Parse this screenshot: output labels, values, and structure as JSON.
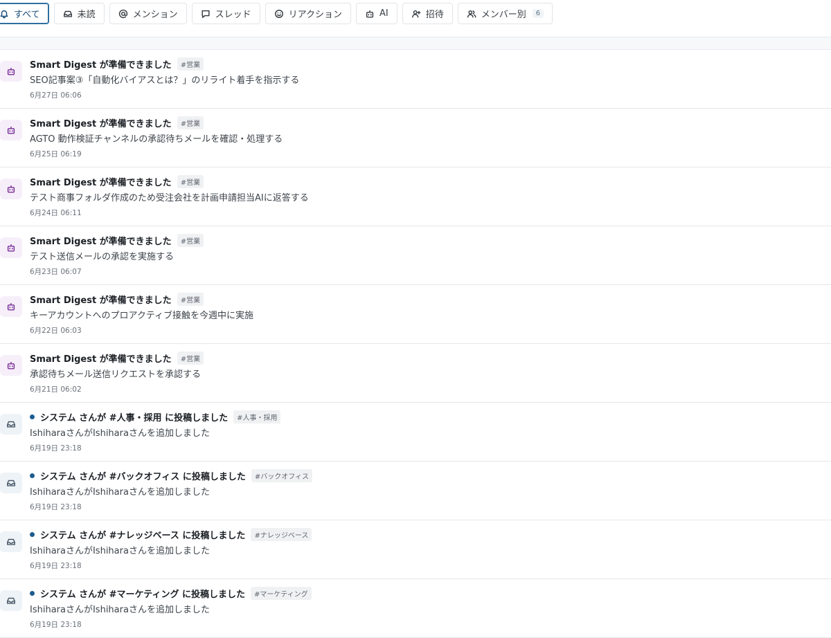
{
  "filters": {
    "all": "すべて",
    "unread": "未読",
    "mentions": "メンション",
    "threads": "スレッド",
    "reactions": "リアクション",
    "ai": "AI",
    "invites": "招待",
    "by_member": "メンバー別",
    "by_member_count": "6"
  },
  "notifications": [
    {
      "kind": "ai",
      "unread": false,
      "title": "Smart Digest が準備できました",
      "tag": "#営業",
      "body": "SEO記事案③「自動化バイアスとは？」のリライト着手を指示する",
      "time": "6月27日 06:06"
    },
    {
      "kind": "ai",
      "unread": false,
      "title": "Smart Digest が準備できました",
      "tag": "#営業",
      "body": "AGTO 動作検証チャンネルの承認待ちメールを確認・処理する",
      "time": "6月25日 06:19"
    },
    {
      "kind": "ai",
      "unread": false,
      "title": "Smart Digest が準備できました",
      "tag": "#営業",
      "body": "テスト商事フォルダ作成のため受注会社を計画申請担当AIに返答する",
      "time": "6月24日 06:11"
    },
    {
      "kind": "ai",
      "unread": false,
      "title": "Smart Digest が準備できました",
      "tag": "#営業",
      "body": "テスト送信メールの承認を実施する",
      "time": "6月23日 06:07"
    },
    {
      "kind": "ai",
      "unread": false,
      "title": "Smart Digest が準備できました",
      "tag": "#営業",
      "body": "キーアカウントへのプロアクティブ接触を今週中に実施",
      "time": "6月22日 06:03"
    },
    {
      "kind": "ai",
      "unread": false,
      "title": "Smart Digest が準備できました",
      "tag": "#営業",
      "body": "承認待ちメール送信リクエストを承認する",
      "time": "6月21日 06:02"
    },
    {
      "kind": "inbox",
      "unread": true,
      "title": "システム さんが #人事・採用 に投稿しました",
      "tag": "#人事・採用",
      "body": "IshiharaさんがIshiharaさんを追加しました",
      "time": "6月19日 23:18"
    },
    {
      "kind": "inbox",
      "unread": true,
      "title": "システム さんが #バックオフィス に投稿しました",
      "tag": "#バックオフィス",
      "body": "IshiharaさんがIshiharaさんを追加しました",
      "time": "6月19日 23:18"
    },
    {
      "kind": "inbox",
      "unread": true,
      "title": "システム さんが #ナレッジベース に投稿しました",
      "tag": "#ナレッジベース",
      "body": "IshiharaさんがIshiharaさんを追加しました",
      "time": "6月19日 23:18"
    },
    {
      "kind": "inbox",
      "unread": true,
      "title": "システム さんが #マーケティング に投稿しました",
      "tag": "#マーケティング",
      "body": "IshiharaさんがIshiharaさんを追加しました",
      "time": "6月19日 23:18"
    }
  ]
}
